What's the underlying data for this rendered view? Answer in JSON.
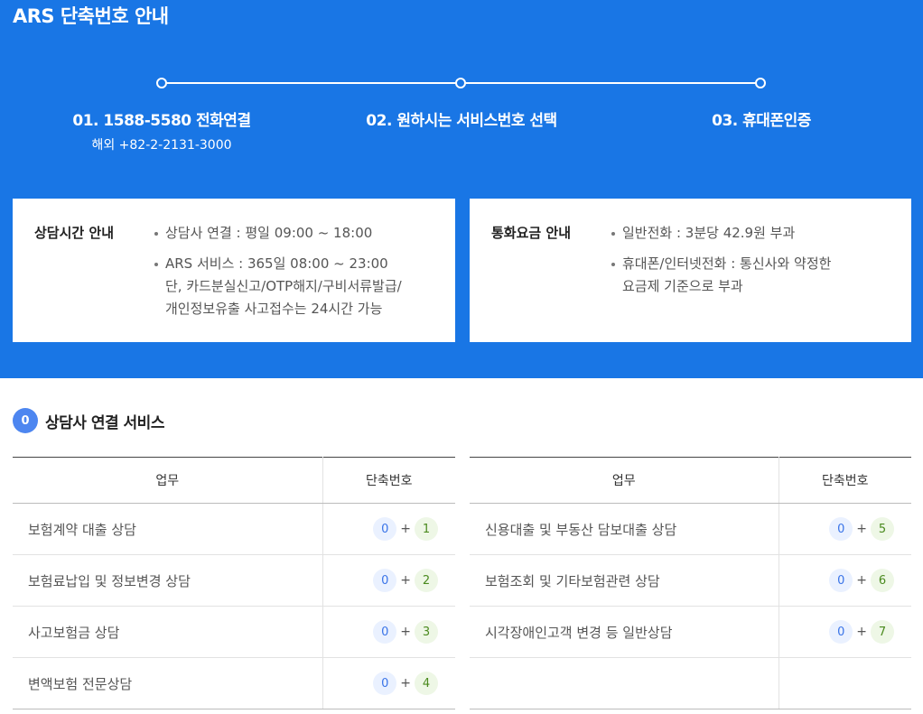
{
  "title": "ARS 단축번호 안내",
  "steps": [
    {
      "label": "01. 1588-5580 전화연결",
      "sub": "해외 +82-2-2131-3000"
    },
    {
      "label": "02. 원하시는 서비스번호 선택"
    },
    {
      "label": "03. 휴대폰인증"
    }
  ],
  "consult_hours": {
    "title": "상담시간 안내",
    "items": [
      "상담사 연결 : 평일 09:00 ~ 18:00",
      "ARS 서비스 : 365일 08:00 ~ 23:00",
      "단, 카드분실신고/OTP해지/구비서류발급/",
      "개인정보유출 사고접수는 24시간 가능"
    ]
  },
  "call_fee": {
    "title": "통화요금 안내",
    "items": [
      "일반전화 : 3분당 42.9원 부과",
      "휴대폰/인터넷전화 : 통신사와 약정한",
      "요금제 기준으로 부과"
    ]
  },
  "section": {
    "badge": "0",
    "title": "상담사 연결 서비스"
  },
  "table": {
    "col_task": "업무",
    "col_code": "단축번호",
    "plus": "+",
    "left_rows": [
      {
        "task": "보험계약 대출 상담",
        "prefix": "0",
        "num": "1"
      },
      {
        "task": "보험료납입 및 정보변경 상담",
        "prefix": "0",
        "num": "2"
      },
      {
        "task": "사고보험금 상담",
        "prefix": "0",
        "num": "3"
      },
      {
        "task": "변액보험 전문상담",
        "prefix": "0",
        "num": "4"
      }
    ],
    "right_rows": [
      {
        "task": "신용대출 및 부동산 담보대출 상담",
        "prefix": "0",
        "num": "5"
      },
      {
        "task": "보험조회 및 기타보험관련 상담",
        "prefix": "0",
        "num": "6"
      },
      {
        "task": "시각장애인고객 변경 등 일반상담",
        "prefix": "0",
        "num": "7"
      }
    ]
  },
  "colors": {
    "hero": "#1976e5",
    "badge": "#4d86f0",
    "key_prefix": "#3a74e8",
    "key_num": "#4a8a1e"
  }
}
